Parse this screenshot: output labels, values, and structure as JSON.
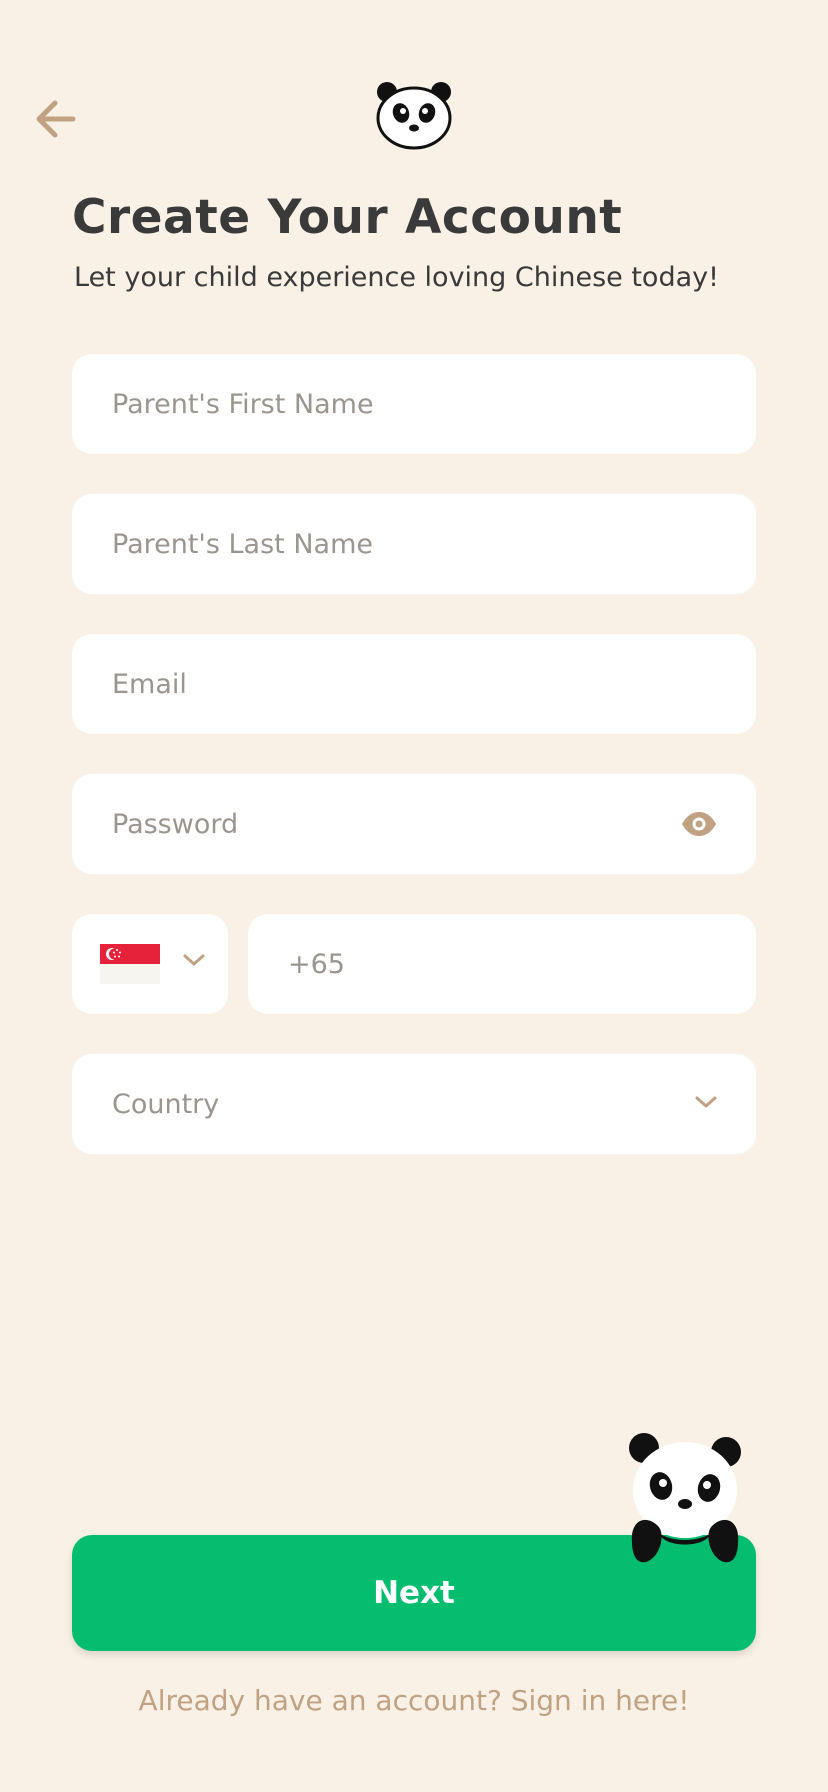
{
  "header": {
    "back_icon": "arrow-left-icon",
    "logo_icon": "panda-face-icon"
  },
  "page": {
    "title": "Create Your Account",
    "subtitle": "Let your child experience loving Chinese today!"
  },
  "form": {
    "first_name": {
      "placeholder": "Parent's First Name",
      "value": ""
    },
    "last_name": {
      "placeholder": "Parent's Last Name",
      "value": ""
    },
    "email": {
      "placeholder": "Email",
      "value": ""
    },
    "password": {
      "placeholder": "Password",
      "value": "",
      "toggle_icon": "eye-icon"
    },
    "phone": {
      "country_flag": "singapore-flag-icon",
      "dropdown_icon": "chevron-down-icon",
      "prefix": "+65",
      "value": ""
    },
    "country": {
      "placeholder": "Country",
      "dropdown_icon": "chevron-down-icon"
    }
  },
  "actions": {
    "next_label": "Next",
    "signin_text": "Already have an account? Sign in here!"
  },
  "colors": {
    "background": "#faf1e6",
    "primary": "#04bd6f",
    "accent": "#c0a283",
    "text": "#3a3a3a",
    "placeholder": "#9a958f"
  }
}
